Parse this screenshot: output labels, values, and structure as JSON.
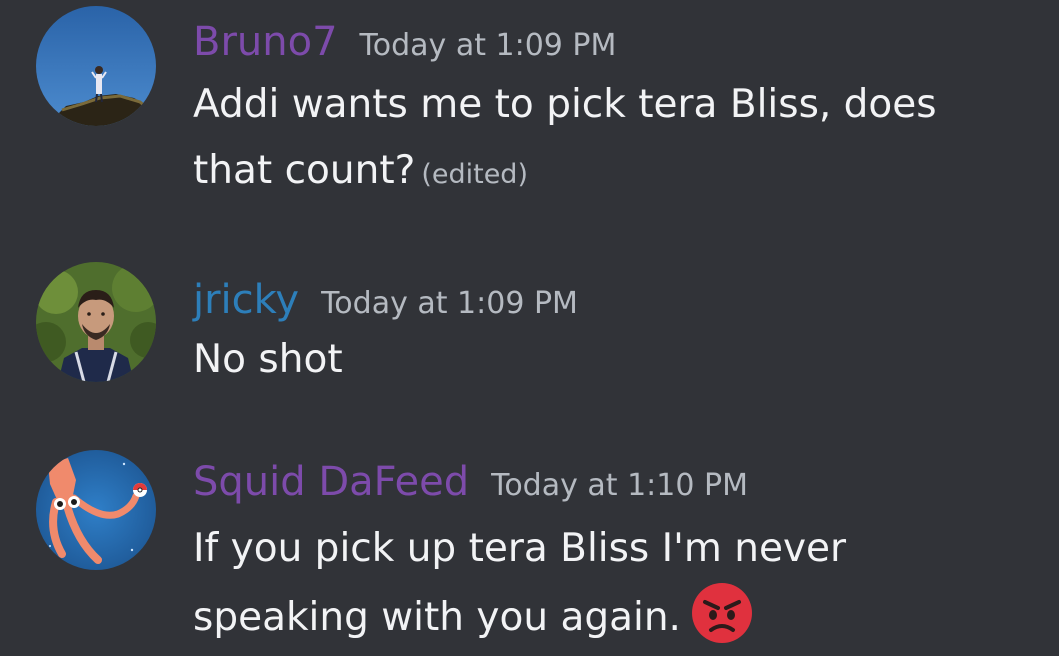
{
  "messages": [
    {
      "username": "Bruno7",
      "username_color": "#7d4bab",
      "timestamp": "Today at 1:09 PM",
      "text": "Addi wants me to pick tera Bliss, does that count?",
      "edited_label": "(edited)",
      "avatar": "avatar-icon"
    },
    {
      "username": "jricky",
      "username_color": "#2d7fba",
      "timestamp": "Today at 1:09 PM",
      "text": "No shot",
      "avatar": "avatar-icon"
    },
    {
      "username": "Squid DaFeed",
      "username_color": "#7d4bab",
      "timestamp": "Today at 1:10 PM",
      "text": "If you pick up tera Bliss I'm never speaking with you again.",
      "emoji": "angry-face-emoji",
      "avatar": "avatar-icon"
    }
  ]
}
